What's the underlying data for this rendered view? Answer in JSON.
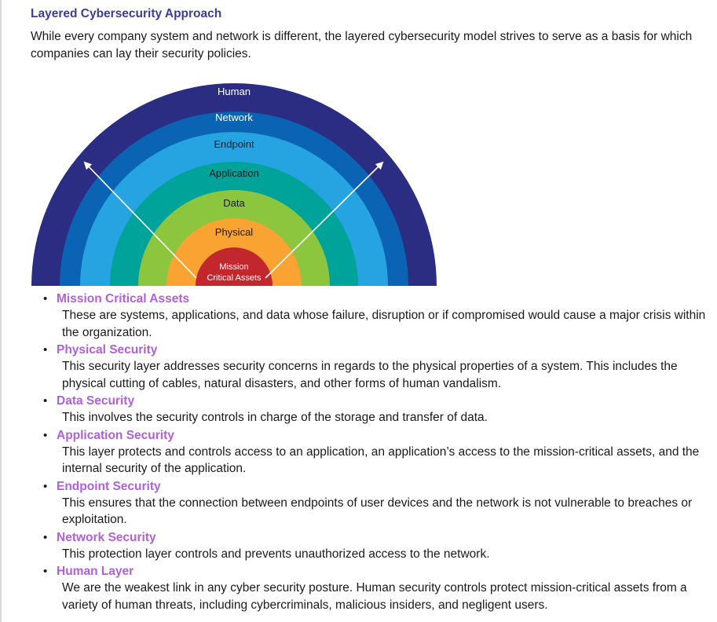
{
  "page": {
    "title": "Layered Cybersecurity Approach",
    "intro": "While every company system and network is different, the layered cybersecurity model strives to serve as a basis for which companies can lay their security policies."
  },
  "diagram": {
    "layers": [
      {
        "label": "Human",
        "color": "#2b2d83",
        "text_color": "#ffffff"
      },
      {
        "label": "Network",
        "color": "#0a63b3",
        "text_color": "#ffffff"
      },
      {
        "label": "Endpoint",
        "color": "#26a4e1",
        "text_color": "#1a1a1a"
      },
      {
        "label": "Application",
        "color": "#00a39a",
        "text_color": "#1a1a1a"
      },
      {
        "label": "Data",
        "color": "#8cc63f",
        "text_color": "#1a1a1a"
      },
      {
        "label": "Physical",
        "color": "#f9a332",
        "text_color": "#1a1a1a"
      },
      {
        "label": "Mission\nCritical Assets",
        "color": "#c1272d",
        "text_color": "#ffffff"
      }
    ],
    "arrow_color": "#ffffff"
  },
  "layers_list": [
    {
      "title": "Mission Critical Assets",
      "description": "These are systems, applications, and data whose failure, disruption or if compromised would cause a major crisis within the organization."
    },
    {
      "title": "Physical Security",
      "description": "This security layer addresses security concerns in regards to the physical properties of a system. This includes the physical cutting of cables, natural disasters, and other forms of human vandalism."
    },
    {
      "title": "Data Security",
      "description": "This involves the security controls in charge of the storage and transfer of data."
    },
    {
      "title": "Application Security",
      "description": "This layer protects and controls access to an application, an application’s access to the mission-critical assets, and the internal security of the application."
    },
    {
      "title": "Endpoint Security",
      "description": "This ensures that the connection between endpoints of user devices and the network is not vulnerable to breaches or exploitation."
    },
    {
      "title": "Network Security",
      "description": "This protection layer controls and prevents unauthorized access to the network."
    },
    {
      "title": "Human Layer",
      "description": "We are the weakest link in any cyber security posture. Human security controls protect mission-critical assets from a variety of human threats, including cybercriminals, malicious insiders, and negligent users."
    }
  ]
}
